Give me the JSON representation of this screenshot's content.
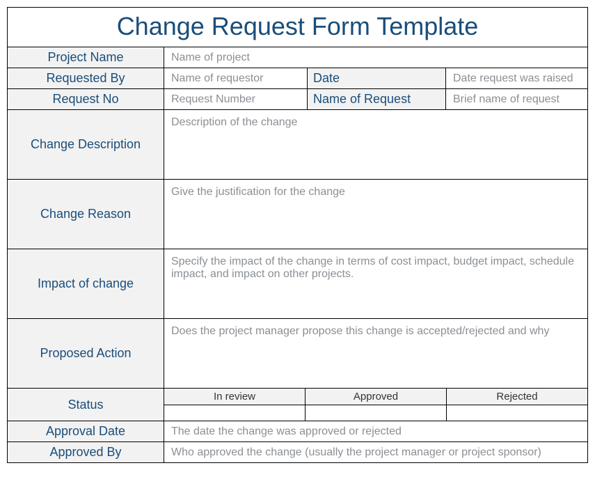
{
  "title": "Change Request Form Template",
  "labels": {
    "project_name": "Project Name",
    "requested_by": "Requested By",
    "date": "Date",
    "request_no": "Request No",
    "name_of_request": "Name of Request",
    "change_description": "Change Description",
    "change_reason": "Change Reason",
    "impact_of_change": "Impact of change",
    "proposed_action": "Proposed Action",
    "status": "Status",
    "approval_date": "Approval Date",
    "approved_by": "Approved By"
  },
  "placeholders": {
    "project_name": "Name of project",
    "requested_by": "Name of requestor",
    "date": "Date request was raised",
    "request_no": "Request Number",
    "name_of_request": "Brief name of request",
    "change_description": "Description of the change",
    "change_reason": "Give the justification for the change",
    "impact_of_change": "Specify the impact of the change in terms of cost impact, budget impact, schedule impact, and impact on other projects.",
    "proposed_action": "Does the project manager propose this change is accepted/rejected and why",
    "approval_date": "The date the change was approved or rejected",
    "approved_by": "Who approved the change (usually the project manager or project sponsor)"
  },
  "status_options": {
    "in_review": "In review",
    "approved": "Approved",
    "rejected": "Rejected"
  }
}
